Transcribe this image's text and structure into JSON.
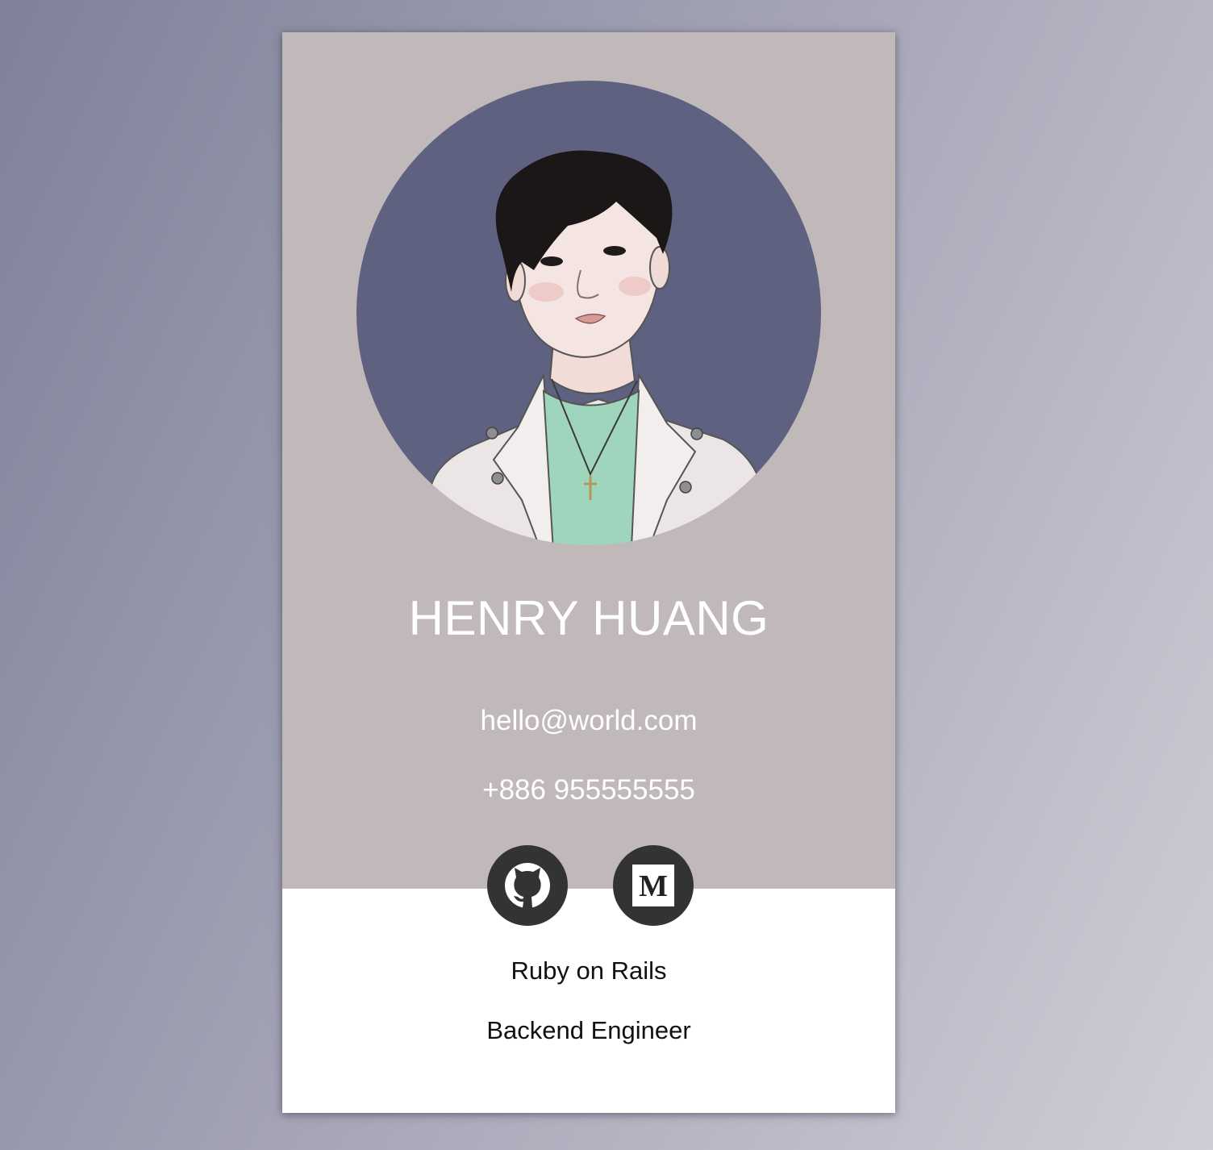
{
  "profile": {
    "name": "HENRY HUANG",
    "email": "hello@world.com",
    "phone": "+886 955555555",
    "skill": "Ruby on Rails",
    "role": "Backend Engineer"
  },
  "social": [
    {
      "icon": "github-icon"
    },
    {
      "icon": "medium-icon",
      "glyph": "M"
    }
  ],
  "colors": {
    "card_top": "#c1b8b9",
    "avatar_bg": "#5e6180",
    "icon_circle": "#333333",
    "page_gradient": [
      "#7f819a",
      "#cfcdd6"
    ]
  }
}
